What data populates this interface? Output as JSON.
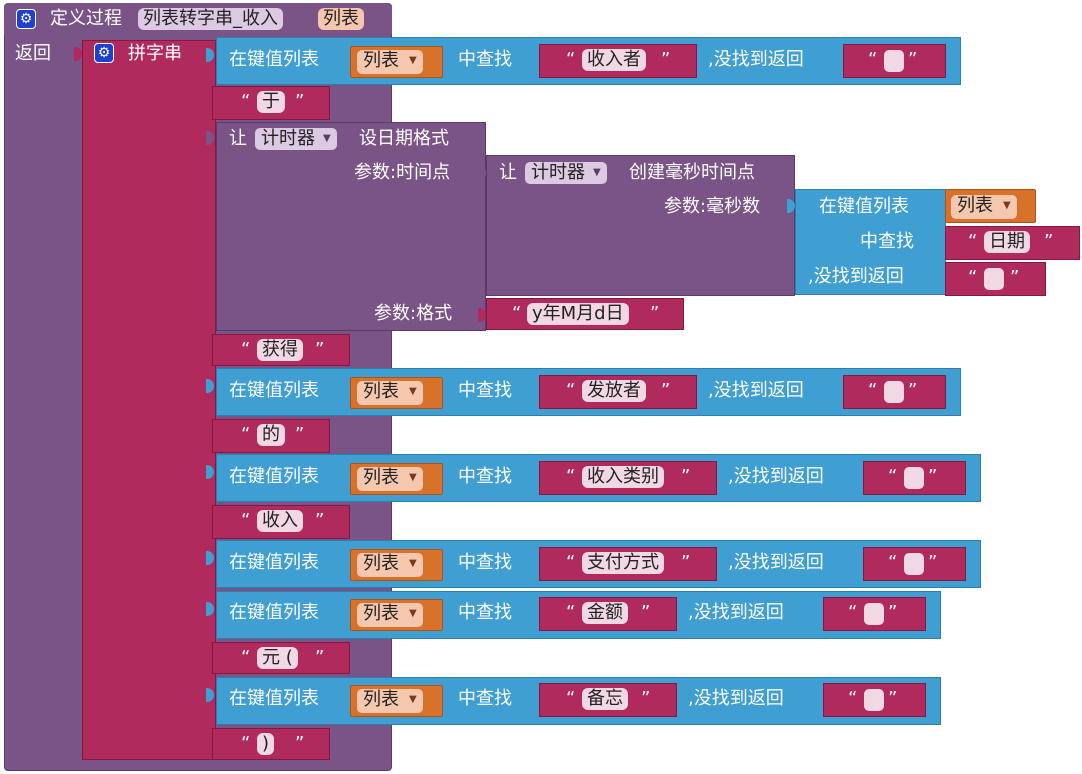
{
  "procedure": {
    "define_label": "定义过程",
    "name": "列表转字串_收入",
    "param": "列表",
    "return_label": "返回"
  },
  "join_label": "拼字串",
  "dict_lookup": {
    "prefix": "在键值列表",
    "find": "中查找",
    "notfound": ",没找到返回",
    "find_vertical": "中查找",
    "notfound_vertical": ",没找到返回"
  },
  "var_list": "列表",
  "keys": {
    "k1": "收入者",
    "k2": "发放者",
    "k3": "收入类别",
    "k4": "支付方式",
    "k5": "金额",
    "k6": "备忘",
    "date": "日期"
  },
  "texts": {
    "t_yu": "于",
    "t_huode": "获得",
    "t_de": "的",
    "t_shouru": "收入",
    "t_yuan": "元 (",
    "t_close": ")"
  },
  "timer": {
    "let": "让",
    "component": "计时器",
    "format_date": "设日期格式",
    "param_time": "参数:时间点",
    "create_ms": "创建毫秒时间点",
    "param_ms": "参数:毫秒数",
    "param_format": "参数:格式",
    "pattern": "y年M月d日"
  },
  "quote_open": "“",
  "quote_close": "”",
  "icons": {
    "gear": "gear-icon",
    "dropdown": "dropdown-arrow-icon"
  },
  "colors": {
    "procedure": "#7a5486",
    "join": "#b02a5e",
    "dict": "#3f9fd2",
    "variable": "#d8722a",
    "text": "#b02a5e"
  }
}
